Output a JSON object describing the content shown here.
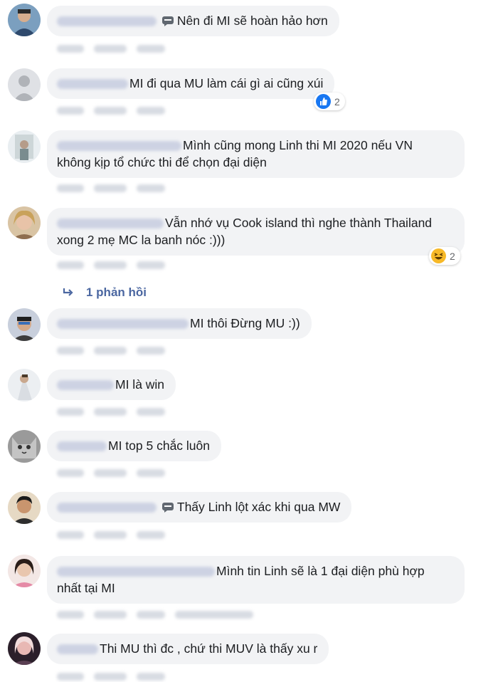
{
  "comments": [
    {
      "text": "Nên đi MI sẽ hoàn hảo hơn",
      "reaction_count": ""
    },
    {
      "text": "MI đi qua MU làm cái gì ai cũng xúi",
      "reaction_count": "2"
    },
    {
      "text_line1": "Mình cũng mong Linh thi MI 2020 nếu VN",
      "text_line2": "không kịp tổ chức thi để chọn đại diện"
    },
    {
      "text_line1": "Vẫn nhớ vụ Cook island thì nghe thành Thailand",
      "text_line2": "xong 2 mẹ MC la banh nóc :)))",
      "reaction_count": "2"
    },
    {
      "text": "MI thôi Đừng MU :))"
    },
    {
      "text": "MI là win"
    },
    {
      "text": "MI top 5 chắc luôn"
    },
    {
      "text": "Thấy Linh lột xác khi qua MW"
    },
    {
      "text_line1": "Mình tin Linh sẽ là 1 đại diện phù hợp",
      "text_line2": "nhất tại MI"
    },
    {
      "text": "Thi MU thì đc , chứ thi MUV là thấy xu r"
    }
  ],
  "replies_link": "1 phản hồi",
  "icons": {
    "like": "like-reaction-icon",
    "haha": "haha-reaction-icon",
    "chat": "chat-bubble-icon",
    "reply": "reply-arrow-icon"
  },
  "colors": {
    "bubble": "#f2f3f5",
    "link": "#4b67a1",
    "like": "#1877f2",
    "haha": "#f7b928"
  }
}
